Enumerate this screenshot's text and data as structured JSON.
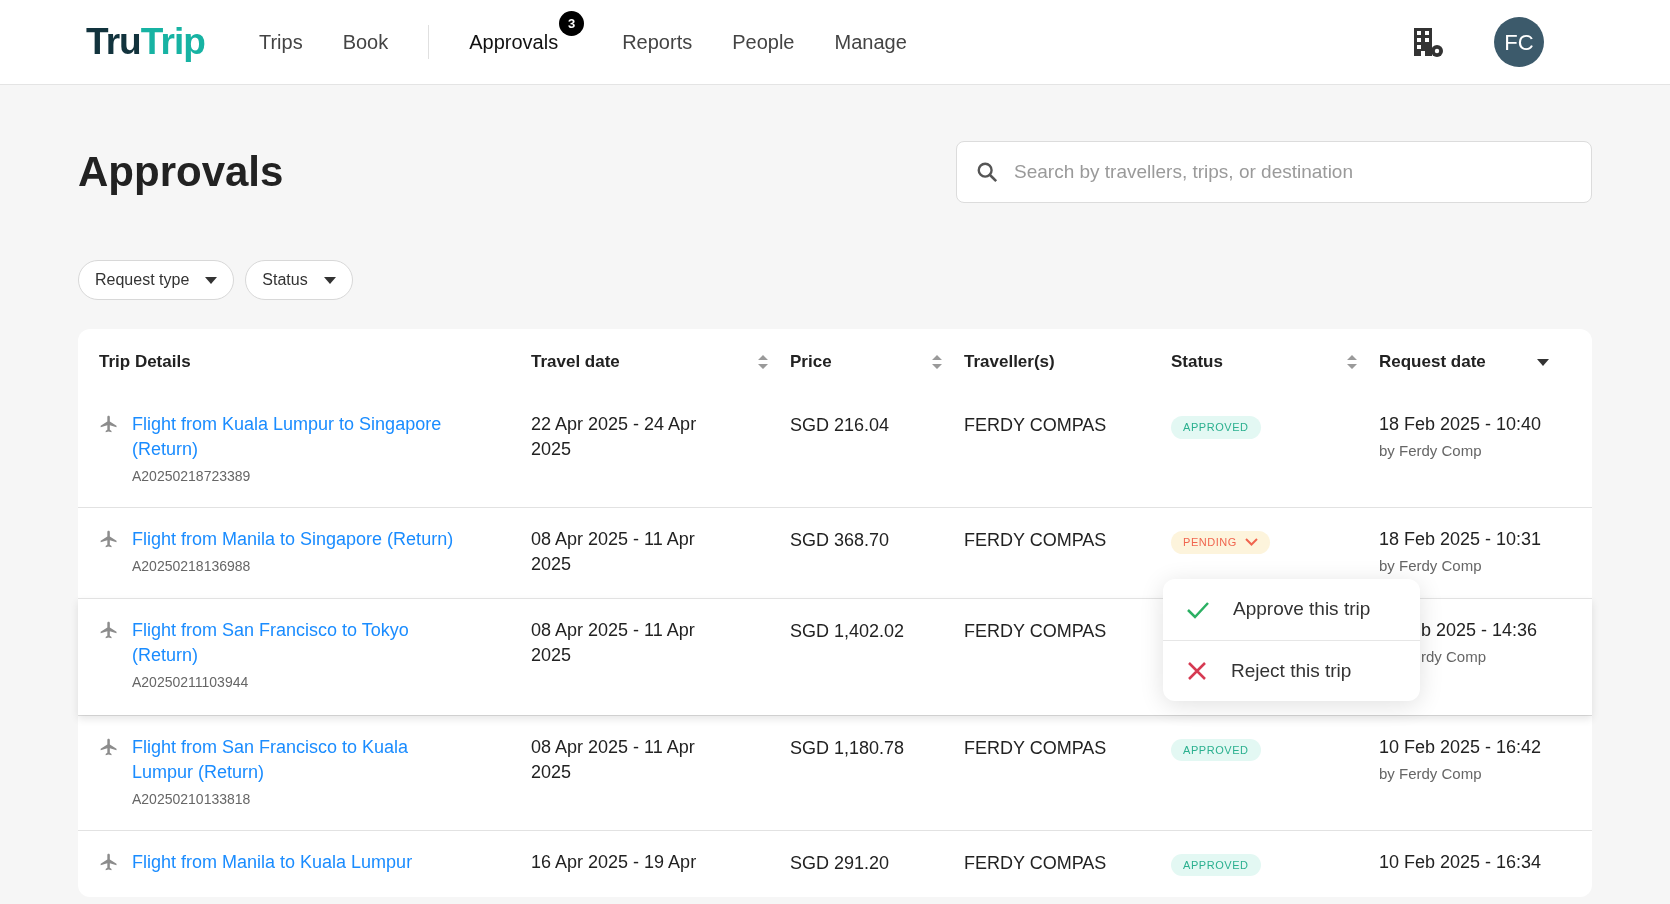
{
  "header": {
    "logo": {
      "part1": "Tru",
      "part2": "Trip"
    },
    "nav": [
      {
        "label": "Trips",
        "selected": false
      },
      {
        "label": "Book",
        "selected": false
      },
      {
        "label": "Approvals",
        "selected": true,
        "badge": "3"
      },
      {
        "label": "Reports",
        "selected": false
      },
      {
        "label": "People",
        "selected": false
      },
      {
        "label": "Manage",
        "selected": false
      }
    ],
    "avatar": "FC"
  },
  "page": {
    "title": "Approvals",
    "search": {
      "placeholder": "Search by travellers, trips, or destination"
    },
    "filters": [
      "Request type",
      "Status"
    ]
  },
  "table": {
    "columns": [
      {
        "label": "Trip Details",
        "sortable": false
      },
      {
        "label": "Travel date",
        "sortable": true,
        "sorted": false
      },
      {
        "label": "Price",
        "sortable": true,
        "sorted": false
      },
      {
        "label": "Traveller(s)",
        "sortable": false
      },
      {
        "label": "Status",
        "sortable": true,
        "sorted": false
      },
      {
        "label": "Request date",
        "sortable": true,
        "sorted": true
      }
    ],
    "rows": [
      {
        "trip": "Flight from Kuala Lumpur to Singapore (Return)",
        "ref": "A20250218723389",
        "travel_date": "22 Apr 2025 - 24 Apr 2025",
        "price": "SGD 216.04",
        "traveller": "FERDY COMPAS",
        "status": {
          "label": "APPROVED",
          "kind": "approved",
          "expanded": false
        },
        "request_date": "18 Feb 2025 - 10:40",
        "requested_by": "by Ferdy Comp",
        "covered": false,
        "hovered": false
      },
      {
        "trip": "Flight from Manila to Singapore (Return)",
        "ref": "A20250218136988",
        "travel_date": "08 Apr 2025 - 11 Apr 2025",
        "price": "SGD 368.70",
        "traveller": "FERDY COMPAS",
        "status": {
          "label": "PENDING",
          "kind": "pending",
          "expanded": true
        },
        "request_date": "18 Feb 2025 - 10:31",
        "requested_by": "by Ferdy Comp",
        "covered": false,
        "hovered": false
      },
      {
        "trip": "Flight from San Francisco to Tokyo (Return)",
        "ref": "A20250211103944",
        "travel_date": "08 Apr 2025 - 11 Apr 2025",
        "price": "SGD 1,402.02",
        "traveller": "FERDY COMPAS",
        "request_date": "b 2025 - 14:36",
        "requested_by": "rdy Comp",
        "covered": true,
        "hovered": true
      },
      {
        "trip": "Flight from San Francisco to Kuala Lumpur (Return)",
        "ref": "A20250210133818",
        "travel_date": "08 Apr 2025 - 11 Apr 2025",
        "price": "SGD 1,180.78",
        "traveller": "FERDY COMPAS",
        "status": {
          "label": "APPROVED",
          "kind": "approved",
          "expanded": false
        },
        "request_date": "10 Feb 2025 - 16:42",
        "requested_by": "by Ferdy Comp",
        "covered": false,
        "hovered": false
      },
      {
        "trip": "Flight from Manila to Kuala Lumpur",
        "travel_date": "16 Apr 2025 - 19 Apr",
        "price": "SGD 291.20",
        "traveller": "FERDY COMPAS",
        "status": {
          "label": "APPROVED",
          "kind": "approved",
          "expanded": false
        },
        "request_date": "10 Feb 2025 - 16:34",
        "covered": false,
        "hovered": false
      }
    ]
  },
  "status_menu": {
    "items": [
      {
        "label": "Approve this trip",
        "kind": "approve"
      },
      {
        "label": "Reject this trip",
        "kind": "reject"
      }
    ]
  }
}
